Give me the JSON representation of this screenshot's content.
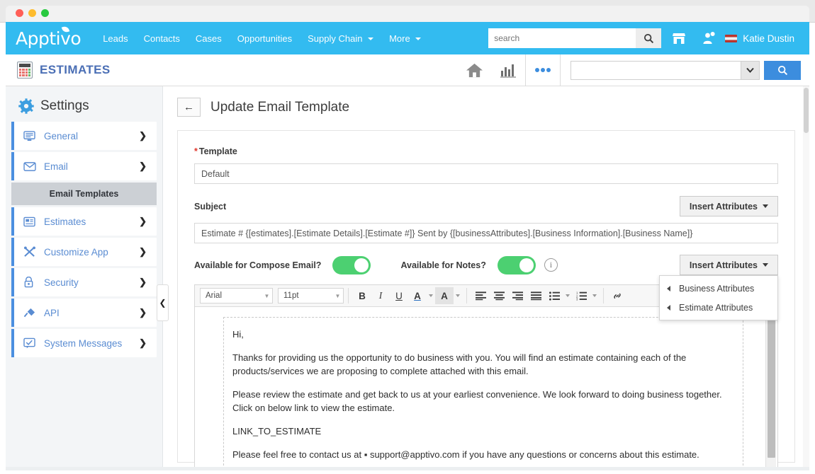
{
  "window": {
    "traffic_lights": [
      "close",
      "minimize",
      "maximize"
    ]
  },
  "top_nav": {
    "brand": "Apptivo",
    "links": [
      {
        "label": "Leads",
        "has_caret": false
      },
      {
        "label": "Contacts",
        "has_caret": false
      },
      {
        "label": "Cases",
        "has_caret": false
      },
      {
        "label": "Opportunities",
        "has_caret": false
      },
      {
        "label": "Supply Chain",
        "has_caret": true
      },
      {
        "label": "More",
        "has_caret": true
      }
    ],
    "search_placeholder": "search",
    "search_value": "",
    "search_icon": "search-icon",
    "store_icon": "store-icon",
    "notifications_icon": "user-notification-icon",
    "user_name": "Katie Dustin",
    "accent_color": "#33bbf0"
  },
  "module_bar": {
    "icon": "calculator-icon",
    "title": "ESTIMATES",
    "home_icon": "home-icon",
    "reports_icon": "bar-chart-icon",
    "more_icon": "ellipsis-icon",
    "search_value": "",
    "search_dropdown_icon": "chevron-down-icon",
    "search_button_icon": "search-icon",
    "search_button_color": "#3c8dde"
  },
  "sidebar": {
    "gear_icon": "gear-icon",
    "title": "Settings",
    "collapse_icon": "chevron-left-icon",
    "items": [
      {
        "label": "General",
        "icon": "monitor-icon",
        "arrow": "chevron-right-icon",
        "expanded": false
      },
      {
        "label": "Email",
        "icon": "envelope-icon",
        "arrow": "chevron-down-icon",
        "expanded": true
      }
    ],
    "sub_item": {
      "label": "Email Templates",
      "active": true
    },
    "items_after": [
      {
        "label": "Estimates",
        "icon": "document-icon",
        "arrow": "chevron-right-icon"
      },
      {
        "label": "Customize App",
        "icon": "tools-icon",
        "arrow": "chevron-right-icon"
      },
      {
        "label": "Security",
        "icon": "lock-icon",
        "arrow": "chevron-right-icon"
      },
      {
        "label": "API",
        "icon": "plug-icon",
        "arrow": "chevron-right-icon"
      },
      {
        "label": "System Messages",
        "icon": "comment-check-icon",
        "arrow": "chevron-right-icon"
      }
    ]
  },
  "page": {
    "back_icon": "back-arrow-icon",
    "title": "Update Email Template"
  },
  "form": {
    "template": {
      "label": "Template",
      "required_marker": "*",
      "value": "Default"
    },
    "subject": {
      "label": "Subject",
      "value": "Estimate # {[estimates].[Estimate Details].[Estimate #]} Sent by {[businessAttributes].[Business Information].[Business Name]}",
      "insert_attributes_label": "Insert Attributes"
    },
    "toggles": [
      {
        "label": "Available for Compose Email?",
        "state": "on",
        "color": "#4cd071"
      },
      {
        "label": "Available for Notes?",
        "state": "on",
        "color": "#4cd071"
      }
    ],
    "info_icon": "info-icon",
    "body_insert_attributes_label": "Insert Attributes",
    "attributes_menu": {
      "open": true,
      "items": [
        {
          "label": "Business Attributes",
          "submenu_icon": "caret-left-icon"
        },
        {
          "label": "Estimate Attributes",
          "submenu_icon": "caret-left-icon"
        }
      ]
    }
  },
  "editor": {
    "font_family": "Arial",
    "font_size": "11pt",
    "buttons": [
      {
        "name": "bold-button",
        "glyph": "B"
      },
      {
        "name": "italic-button",
        "glyph": "I"
      },
      {
        "name": "underline-button",
        "glyph": "U"
      },
      {
        "name": "text-color-button",
        "glyph": "A"
      },
      {
        "name": "highlight-color-button",
        "glyph": "A"
      },
      {
        "name": "align-left-button",
        "glyph": "≡"
      },
      {
        "name": "align-center-button",
        "glyph": "≡"
      },
      {
        "name": "align-right-button",
        "glyph": "≡"
      },
      {
        "name": "align-justify-button",
        "glyph": "≡"
      },
      {
        "name": "bullet-list-button",
        "glyph": "☰"
      },
      {
        "name": "numbered-list-button",
        "glyph": "☰"
      },
      {
        "name": "link-button",
        "glyph": "🔗"
      }
    ],
    "content": [
      "Hi,",
      "Thanks for providing us the opportunity to do business with you. You will find an estimate containing each of the products/services we are proposing to complete attached with this email.",
      "Please review the estimate and get back to us at your earliest convenience. We look forward to doing business together. Click on below link to view the estimate.",
      "LINK_TO_ESTIMATE",
      "Please feel free to contact us at ▪ support@apptivo.com if you have any questions or concerns about this estimate."
    ]
  }
}
